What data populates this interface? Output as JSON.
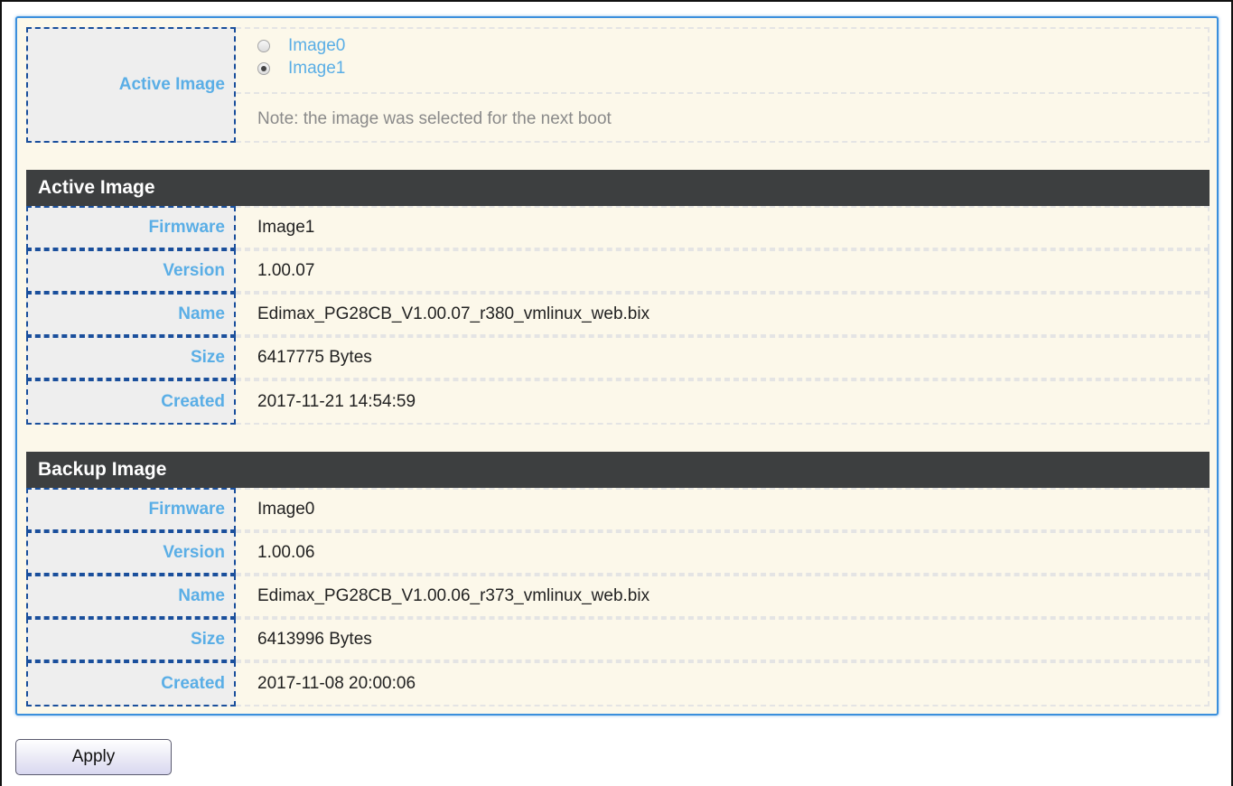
{
  "boot_selection": {
    "label": "Active Image",
    "options": [
      {
        "label": "Image0",
        "checked": false
      },
      {
        "label": "Image1",
        "checked": true
      }
    ],
    "note": "Note: the image was selected for the next boot"
  },
  "active_image": {
    "header": "Active Image",
    "rows": [
      {
        "label": "Firmware",
        "value": "Image1"
      },
      {
        "label": "Version",
        "value": "1.00.07"
      },
      {
        "label": "Name",
        "value": "Edimax_PG28CB_V1.00.07_r380_vmlinux_web.bix"
      },
      {
        "label": "Size",
        "value": "6417775 Bytes"
      },
      {
        "label": "Created",
        "value": "2017-11-21 14:54:59"
      }
    ]
  },
  "backup_image": {
    "header": "Backup Image",
    "rows": [
      {
        "label": "Firmware",
        "value": "Image0"
      },
      {
        "label": "Version",
        "value": "1.00.06"
      },
      {
        "label": "Name",
        "value": "Edimax_PG28CB_V1.00.06_r373_vmlinux_web.bix"
      },
      {
        "label": "Size",
        "value": "6413996 Bytes"
      },
      {
        "label": "Created",
        "value": "2017-11-08 20:00:06"
      }
    ]
  },
  "actions": {
    "apply_label": "Apply"
  },
  "colors": {
    "panel_border": "#3b8fdc",
    "panel_bg": "#fcf8ea",
    "label_text": "#5aaee6",
    "header_bg": "#3d3f40"
  }
}
